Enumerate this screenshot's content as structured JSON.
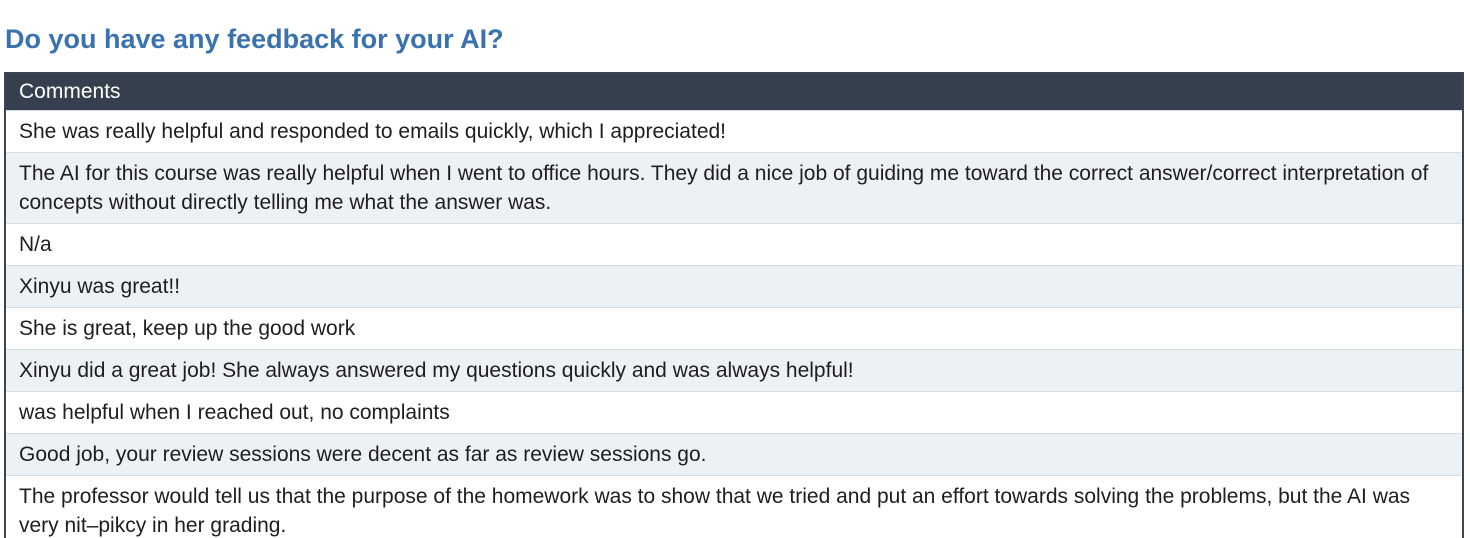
{
  "question": {
    "title": "Do you have any feedback for your AI?"
  },
  "table": {
    "header": "Comments",
    "rows": [
      "She was really helpful and responded to emails quickly, which I appreciated!",
      "The AI for this course was really helpful when I went to office hours. They did a nice job of guiding me toward the correct answer/correct interpretation of concepts without directly telling me what the answer was.",
      "N/a",
      "Xinyu was great!!",
      "She is great, keep up the good work",
      "Xinyu did a great job! She always answered my questions quickly and was always helpful!",
      "was helpful when I reached out, no complaints",
      "Good job, your review sessions were decent as far as review sessions go.",
      "The professor would tell us that the purpose of the homework was to show that we tried and put an effort towards solving the problems, but the AI was very nit–pikcy in her grading."
    ]
  },
  "colors": {
    "title": "#3a72b0",
    "header_background": "#363f4e",
    "row_alt_background": "#ecf1f4"
  }
}
